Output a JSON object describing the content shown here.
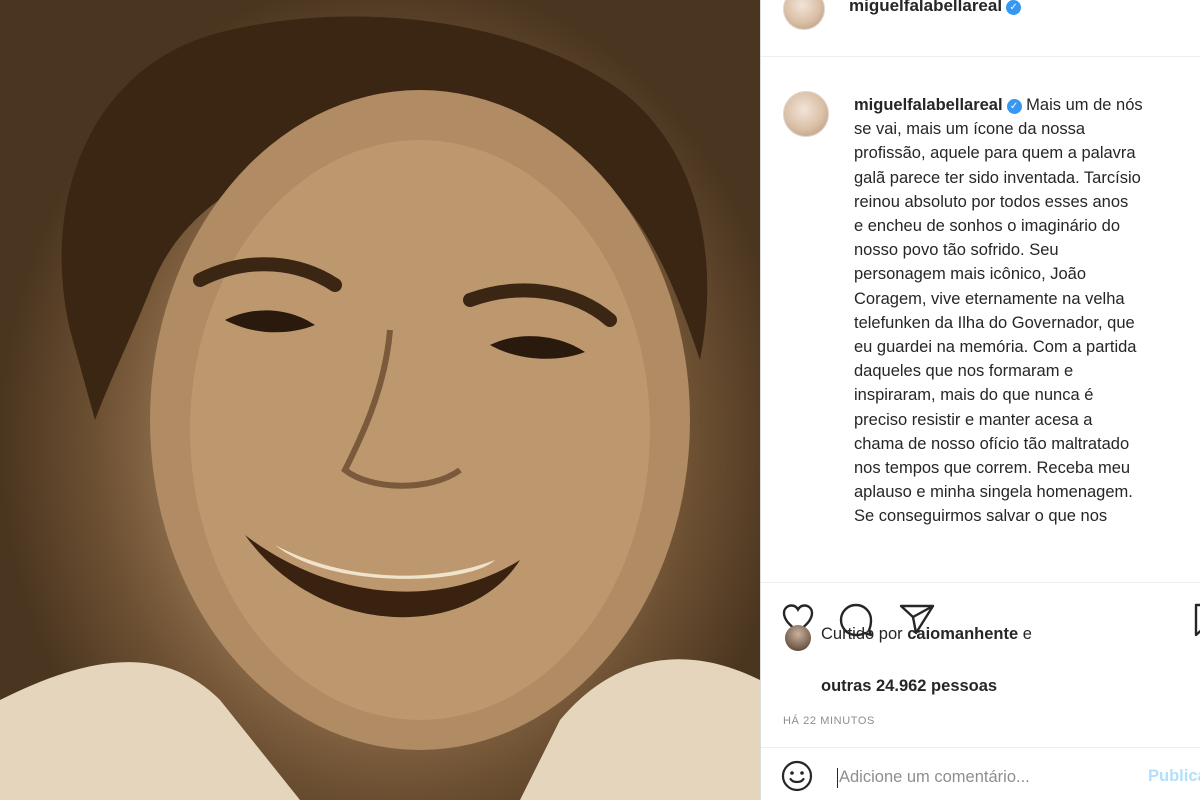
{
  "post": {
    "username": "miguelfalabellareal",
    "verified": true,
    "photo_description_icon": "portrait-photo",
    "caption_lines": [
      "Mais um de nós",
      "se vai, mais um ícone da nossa",
      "profissão, aquele para quem a palavra",
      "galã parece ter sido inventada. Tarcísio",
      "reinou absoluto por todos esses anos",
      "e encheu de sonhos o imaginário do",
      "nosso povo tão sofrido. Seu",
      "personagem mais icônico, João",
      "Coragem, vive eternamente na velha",
      "telefunken da Ilha do Governador, que",
      "eu guardei na memória. Com a partida",
      "daqueles que nos formaram e",
      "inspiraram, mais do que nunca é",
      "preciso resistir e manter acesa a",
      "chama de nosso ofício tão maltratado",
      "nos tempos que correm. Receba meu",
      "aplauso e minha singela homenagem.",
      "Se conseguirmos salvar o que nos"
    ]
  },
  "likes": {
    "prefix": "Curtido por ",
    "liker": "caiomanhente",
    "suffix": " e",
    "others": "outras 24.962 pessoas"
  },
  "timestamp": "HÁ 22 MINUTOS",
  "comment": {
    "placeholder": "Adicione um comentário...",
    "value": "",
    "publish_label": "Publicar"
  },
  "icons": {
    "like": "heart-icon",
    "comment": "comment-icon",
    "share": "send-icon",
    "save": "bookmark-icon",
    "emoji": "emoji-icon"
  },
  "colors": {
    "verified": "#3897f0",
    "publish_disabled": "#b2dffc",
    "muted": "#8e8e8e",
    "text": "#262626"
  }
}
